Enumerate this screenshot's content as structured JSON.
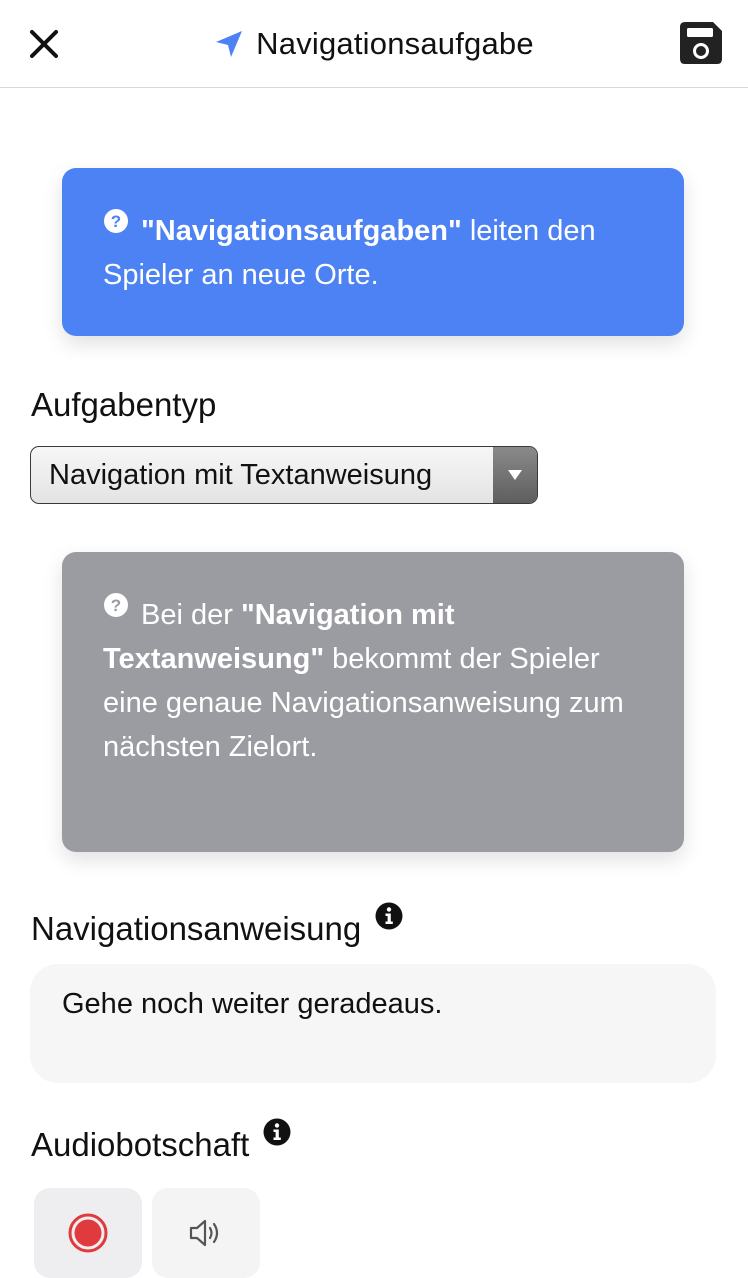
{
  "header": {
    "title": "Navigationsaufgabe",
    "close_icon": "close-icon",
    "nav_icon": "navigation-arrow-icon",
    "save_icon": "save-disk-icon"
  },
  "intro_box": {
    "bold_text": "\"Navigationsaufgaben\"",
    "rest_text": " leiten den Spieler an neue Orte.",
    "icon": "question-circle-icon",
    "background": "#4c82f3"
  },
  "task_type": {
    "label": "Aufgabentyp",
    "selected": "Navigation mit Textanweisung"
  },
  "type_help_box": {
    "prefix": "Bei der ",
    "bold_text": "\"Navigation mit Textanweisung\"",
    "rest_text": " bekommt der Spieler eine genaue Navigationsanweisung zum nächsten Zielort.",
    "icon": "question-circle-icon",
    "background": "#9b9ca2"
  },
  "instruction": {
    "label": "Navigationsanweisung",
    "value": "Gehe noch weiter geradeaus.",
    "info_icon": "info-circle-icon"
  },
  "audio": {
    "label": "Audiobotschaft",
    "info_icon": "info-circle-icon",
    "record_icon": "record-icon",
    "play_icon": "speaker-icon",
    "record_color": "#e0393e"
  }
}
